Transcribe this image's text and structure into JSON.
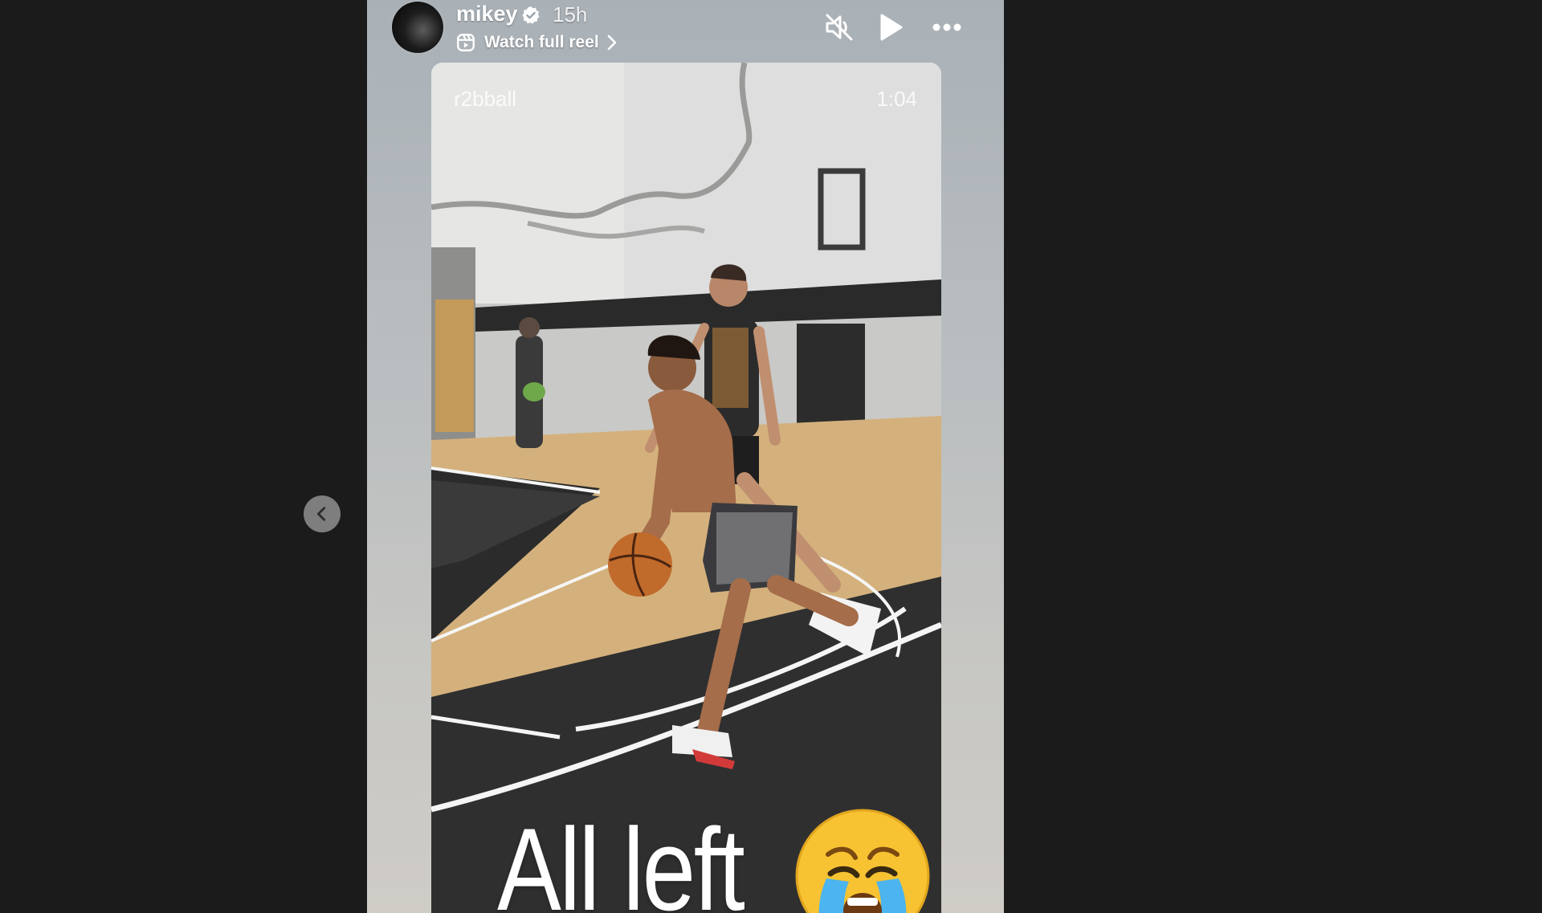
{
  "story": {
    "username": "mikey",
    "verified": true,
    "time_ago": "15h",
    "reel_link_label": "Watch full reel"
  },
  "controls": {
    "mute_icon": "speaker-muted-icon",
    "play_icon": "play-icon",
    "more_icon": "more-dots-icon",
    "prev_icon": "chevron-left-icon"
  },
  "video": {
    "watermark": "r2bball",
    "duration": "1:04",
    "caption": "All left",
    "caption_emoji": "crying-face-emoji"
  },
  "colors": {
    "page_background": "#1b1b1b",
    "text": "#ffffff",
    "prev_button": "#7e7e7e"
  }
}
